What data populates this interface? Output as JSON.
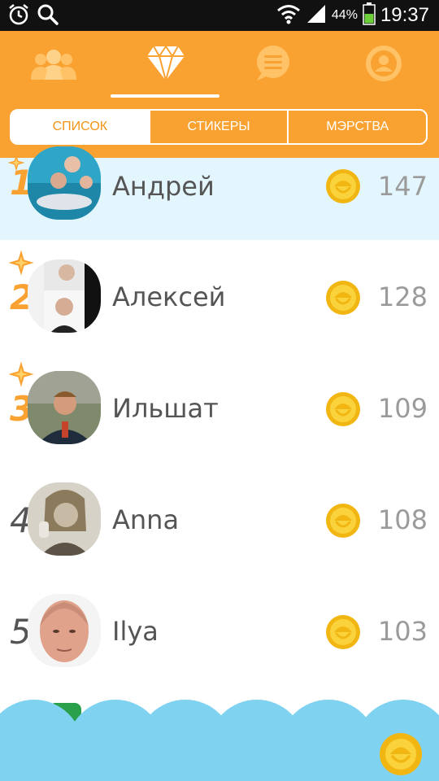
{
  "status_bar": {
    "time": "19:37",
    "battery": "44%",
    "icons": [
      "alarm-icon",
      "search-icon",
      "wifi-icon",
      "signal-icon",
      "battery-icon"
    ]
  },
  "top_nav": {
    "items": [
      {
        "name": "friends",
        "icon": "people-icon",
        "active": false
      },
      {
        "name": "gifts",
        "icon": "diamond-icon",
        "active": true
      },
      {
        "name": "messages",
        "icon": "chat-icon",
        "active": false
      },
      {
        "name": "profile",
        "icon": "user-icon",
        "active": false
      }
    ]
  },
  "tabs": [
    "СПИСОК",
    "СТИКЕРЫ",
    "МЭРСТВА"
  ],
  "active_tab": 0,
  "leaderboard": [
    {
      "rank": "1",
      "name": "Андрей",
      "score": "147",
      "highlighted": true
    },
    {
      "rank": "2",
      "name": "Алексей",
      "score": "128",
      "highlighted": false
    },
    {
      "rank": "3",
      "name": "Ильшат",
      "score": "109",
      "highlighted": false
    },
    {
      "rank": "4",
      "name": "Anna",
      "score": "108",
      "highlighted": false
    },
    {
      "rank": "5",
      "name": "Ilya",
      "score": "103",
      "highlighted": false
    }
  ],
  "colors": {
    "accent": "#f9a232",
    "highlight_row": "#e3f5fd",
    "cloud": "#7fd2f0",
    "coin": "#f7c51b"
  }
}
